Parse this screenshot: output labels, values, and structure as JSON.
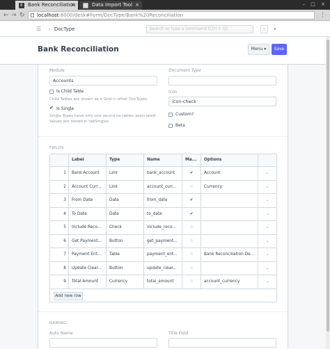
{
  "browser": {
    "tabs": [
      {
        "title": "Bank Reconciliation",
        "favicon": "E",
        "active": true
      },
      {
        "title": "Data Import Tool",
        "favicon": "",
        "active": false
      }
    ],
    "url_host": "localhost",
    "url_rest": ":8000/desk#Form/DocType/Bank%20Reconciliation"
  },
  "navbar": {
    "breadcrumb": "DocType",
    "search_placeholder": "Search or type a command (Ctrl + G)",
    "avatar_initial": "A"
  },
  "page": {
    "title": "Bank Reconciliation",
    "menu_label": "Menu",
    "save_label": "Save"
  },
  "form": {
    "module_label": "Module",
    "module_value": "Accounts",
    "document_type_label": "Document Type",
    "document_type_value": "",
    "is_child_table_label": "Is Child Table",
    "is_child_table_checked": false,
    "is_child_table_help": "Child Tables are shown as a Grid in other DocTypes.",
    "is_single_label": "Is Single",
    "is_single_checked": true,
    "is_single_help_1": "Single Types have only one record no tables associated.",
    "is_single_help_2": "Values are stored in tabSingles",
    "icon_label": "Icon",
    "icon_value": "icon-check",
    "custom_label": "Custom?",
    "custom_checked": false,
    "beta_label": "Beta",
    "beta_checked": false
  },
  "fields_section": {
    "heading": "FIELDS",
    "columns": [
      "Label",
      "Type",
      "Name",
      "Ma...",
      "Options"
    ],
    "rows": [
      {
        "idx": "1",
        "label": "Bank Account",
        "type": "Link",
        "name": "bank_account",
        "mandatory": true,
        "options": "Account"
      },
      {
        "idx": "2",
        "label": "Account Curr...",
        "type": "Link",
        "name": "account_curr...",
        "mandatory": false,
        "options": "Currency"
      },
      {
        "idx": "3",
        "label": "From Date",
        "type": "Date",
        "name": "from_date",
        "mandatory": true,
        "options": ""
      },
      {
        "idx": "4",
        "label": "To Date",
        "type": "Date",
        "name": "to_date",
        "mandatory": true,
        "options": ""
      },
      {
        "idx": "5",
        "label": "Include Reco...",
        "type": "Check",
        "name": "include_reco...",
        "mandatory": false,
        "options": ""
      },
      {
        "idx": "6",
        "label": "Get Payment...",
        "type": "Button",
        "name": "get_payment...",
        "mandatory": false,
        "options": ""
      },
      {
        "idx": "7",
        "label": "Payment Ent...",
        "type": "Table",
        "name": "payment_ent...",
        "mandatory": false,
        "options": "Bank Reconciliation De..."
      },
      {
        "idx": "8",
        "label": "Update Clear...",
        "type": "Button",
        "name": "update_clear...",
        "mandatory": false,
        "options": ""
      },
      {
        "idx": "9",
        "label": "Total Amount",
        "type": "Currency",
        "name": "total_amount",
        "mandatory": false,
        "options": "account_currency"
      }
    ],
    "add_row_label": "Add new row"
  },
  "naming_section": {
    "heading": "NAMING",
    "autoname_label": "Auto Name",
    "title_field_label": "Title Field"
  },
  "colors": {
    "primary": "#5e64ff",
    "border": "#d1d8dd",
    "muted_text": "#8d99a6",
    "text": "#36414c"
  }
}
